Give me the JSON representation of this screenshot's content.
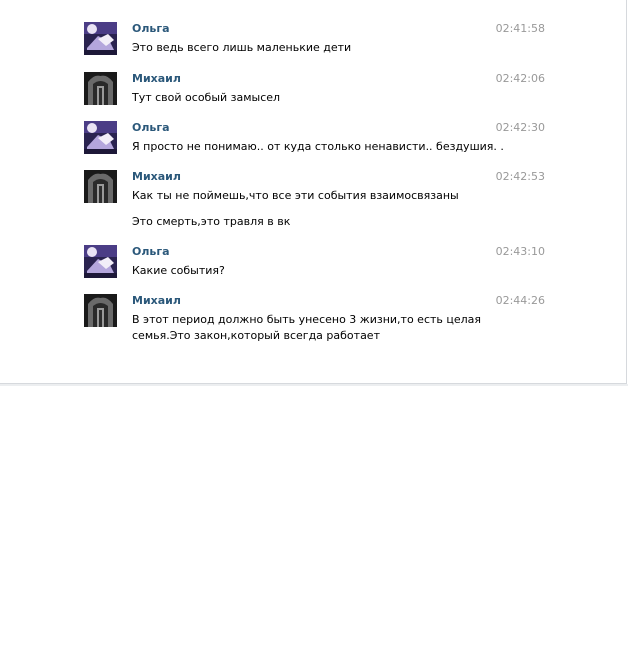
{
  "messages": [
    {
      "author": "Ольга",
      "time": "02:41:58",
      "lines": [
        "Это ведь всего лишь маленькие дети"
      ]
    },
    {
      "author": "Михаил",
      "time": "02:42:06",
      "lines": [
        "Тут свой особый замысел"
      ]
    },
    {
      "author": "Ольга",
      "time": "02:42:30",
      "lines": [
        "Я просто не понимаю.. от куда столько ненависти.. бездушия. ."
      ]
    },
    {
      "author": "Михаил",
      "time": "02:42:53",
      "lines": [
        "Как ты не поймешь,что все эти события взаимосвязаны",
        "Это смерть,это травля в вк"
      ]
    },
    {
      "author": "Ольга",
      "time": "02:43:10",
      "lines": [
        "Какие события?"
      ]
    },
    {
      "author": "Михаил",
      "time": "02:44:26",
      "lines": [
        "В этот период должно быть унесено 3 жизни,то есть целая",
        "семья.Это закон,который всегда работает"
      ]
    }
  ],
  "colors": {
    "author": "#2b587a",
    "time": "#999999",
    "text": "#000000",
    "border": "#d6d9dd"
  },
  "icons": {
    "olga_avatar": "avatar-photo-purple",
    "mikhail_avatar": "avatar-photo-gray"
  }
}
